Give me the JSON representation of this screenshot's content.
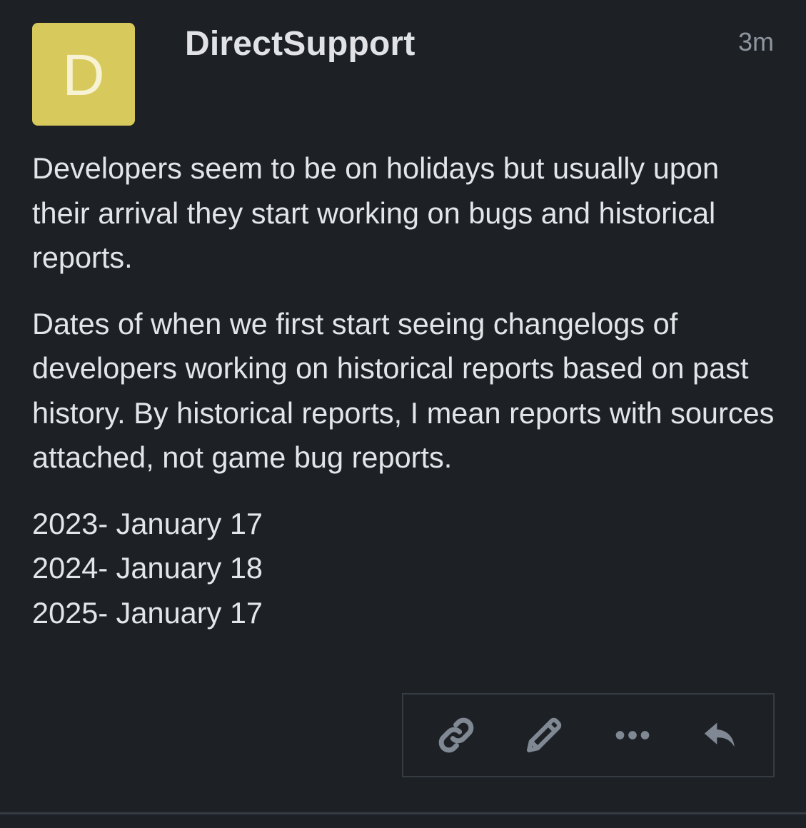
{
  "post": {
    "avatar_letter": "D",
    "avatar_color": "#d8c95c",
    "username": "DirectSupport",
    "timestamp": "3m",
    "paragraphs": [
      "Developers seem to be on holidays but usually upon their arrival they start working on bugs and historical reports.",
      "Dates of when we first start seeing changelogs of developers working on historical reports based on past history. By historical reports, I mean reports with sources attached, not game bug reports."
    ],
    "dates": [
      "2023- January 17",
      "2024- January 18",
      "2025- January 17"
    ]
  },
  "actions": {
    "icons": [
      "link-icon",
      "pencil-icon",
      "more-icon",
      "reply-icon"
    ],
    "icon_color": "#7f8893"
  }
}
